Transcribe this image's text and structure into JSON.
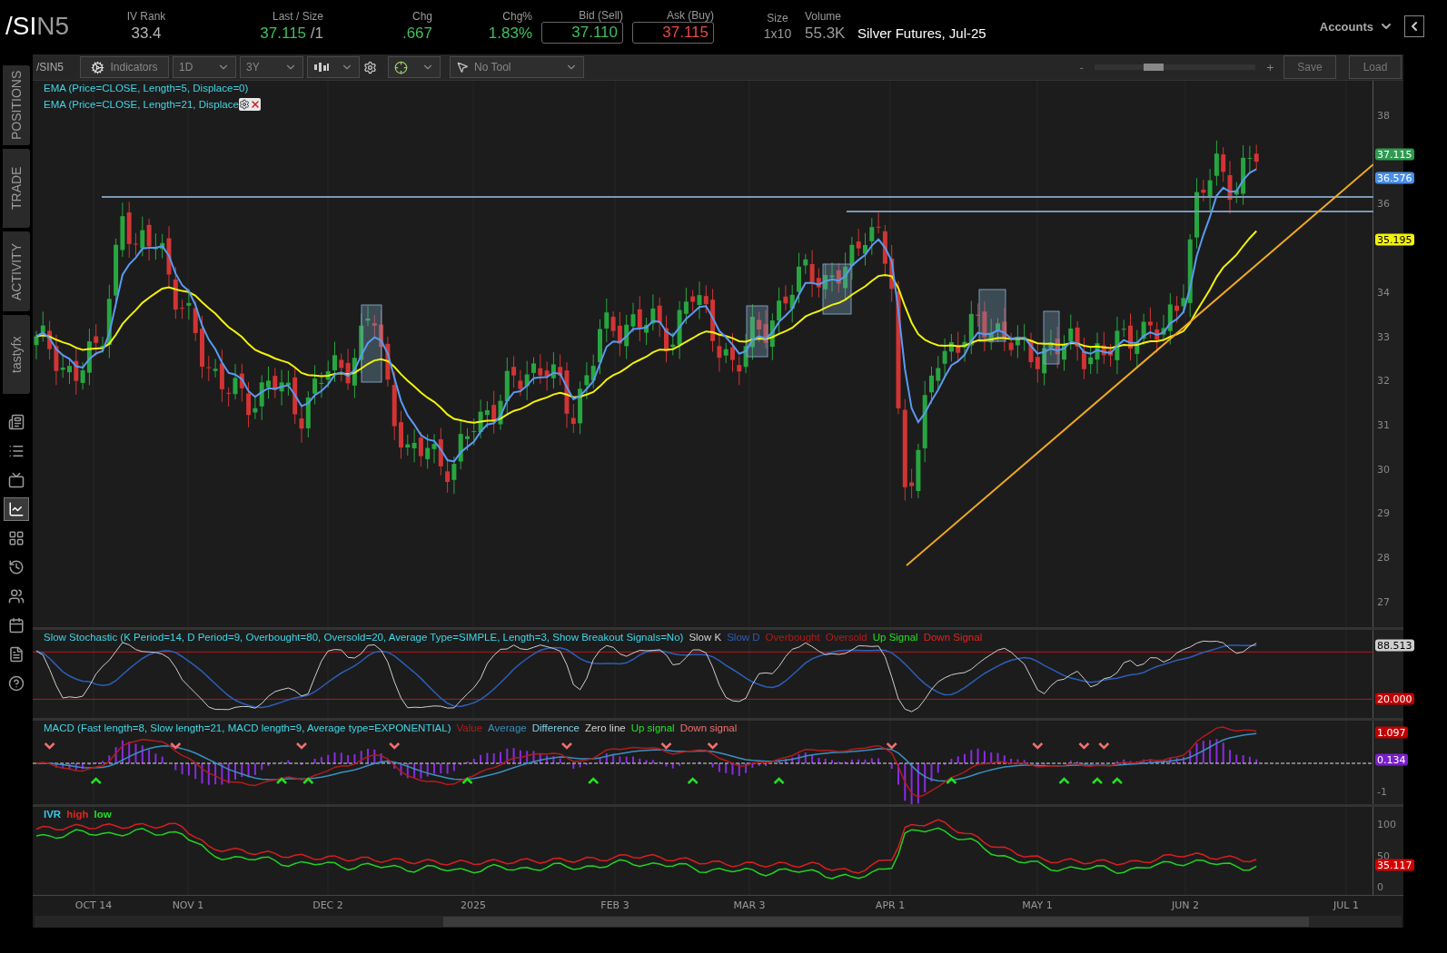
{
  "header": {
    "symbol": {
      "root": "/SI",
      "contract": "N5"
    },
    "quotes": [
      {
        "label": "IV Rank",
        "value": "33.4",
        "kind": "plain",
        "color": "#b5b5b5"
      },
      {
        "label": "Last / Size",
        "value": "37.115",
        "extra": "/1",
        "kind": "plain",
        "color": "#3fbf5f"
      },
      {
        "label": "Chg",
        "value": ".667",
        "kind": "plain",
        "color": "#3fbf5f"
      },
      {
        "label": "Chg%",
        "value": "1.83%",
        "kind": "plain",
        "color": "#3fbf5f"
      },
      {
        "label": "Bid (Sell)",
        "value": "37.110",
        "kind": "boxed",
        "color": "#3fbf5f"
      },
      {
        "label": "Ask (Buy)",
        "value": "37.115",
        "kind": "boxed",
        "color": "#e84848"
      },
      {
        "label": "Size",
        "value": "1x10",
        "kind": "small",
        "color": "#9a9a9a"
      },
      {
        "label": "Volume",
        "value": "55.3K",
        "kind": "plain",
        "color": "#9a9a9a"
      }
    ],
    "description": "Silver Futures, Jul-25",
    "accounts": "Accounts"
  },
  "sidebar": {
    "tabs": [
      {
        "label": "POSITIONS",
        "selected": false
      },
      {
        "label": "TRADE",
        "selected": false
      },
      {
        "label": "ACTIVITY",
        "selected": false
      },
      {
        "label": "tastyfx",
        "selected": false
      }
    ],
    "icons": [
      {
        "kind": "news",
        "selected": false
      },
      {
        "kind": "list",
        "selected": false
      },
      {
        "kind": "tv",
        "selected": false
      },
      {
        "kind": "chart",
        "selected": true
      },
      {
        "kind": "grid",
        "selected": false
      },
      {
        "kind": "history",
        "selected": false
      },
      {
        "kind": "community",
        "selected": false
      },
      {
        "kind": "calendar",
        "selected": false
      },
      {
        "kind": "document",
        "selected": false
      },
      {
        "kind": "help",
        "selected": false
      }
    ]
  },
  "toolbar": {
    "symbol": "/SIN5",
    "indicators": "Indicators",
    "aggregation": "1D",
    "range": "3Y",
    "tool": "No Tool",
    "zoom": {
      "minus": "-",
      "plus": "+",
      "level": 0.35
    },
    "buttons": [
      "Save",
      "Load"
    ]
  },
  "chart": {
    "studies": [
      {
        "label": "EMA (Price=CLOSE, Length=5, Displace=0)",
        "has_controls": false
      },
      {
        "label": "EMA (Price=CLOSE, Length=21, Displace",
        "has_controls": true
      }
    ],
    "price_ticks": [
      "38",
      "36",
      "34",
      "33",
      "32",
      "31",
      "30",
      "29",
      "28",
      "27"
    ],
    "price_tags": [
      {
        "value": "37.115",
        "color": "#2e9b4e"
      },
      {
        "value": "36.576",
        "color": "#4a8fe8"
      },
      {
        "value": "35.195",
        "color": "#f2f20a"
      }
    ]
  },
  "stochastic": {
    "title": "Slow Stochastic (K Period=14, D Period=9, Overbought=80, Oversold=20, Average Type=SIMPLE, Length=3, Show Breakout Signals=No)",
    "legend": [
      {
        "label": "Slow K",
        "color": "#d0d0d0"
      },
      {
        "label": "Slow D",
        "color": "#2c5fb8"
      },
      {
        "label": "Overbought",
        "color": "#b01c1c"
      },
      {
        "label": "Oversold",
        "color": "#b01c1c"
      },
      {
        "label": "Up Signal",
        "color": "#22e022"
      },
      {
        "label": "Down Signal",
        "color": "#e02222"
      }
    ],
    "tags": [
      {
        "value": "88.513",
        "color": "#cfcfcf"
      },
      {
        "value": "20.000",
        "color": "#c00000"
      }
    ]
  },
  "macd": {
    "title": "MACD (Fast length=8, Slow length=21, MACD length=9, Average type=EXPONENTIAL)",
    "legend": [
      {
        "label": "Value",
        "color": "#b01c1c"
      },
      {
        "label": "Average",
        "color": "#3a8fc0"
      },
      {
        "label": "Difference",
        "color": "#7fd0e8"
      },
      {
        "label": "Zero line",
        "color": "#d0d0d0"
      },
      {
        "label": "Up signal",
        "color": "#22e022"
      },
      {
        "label": "Down signal",
        "color": "#f07070"
      }
    ],
    "ticks": [
      "-1"
    ],
    "tags": [
      {
        "value": "1.097",
        "color": "#c00000"
      },
      {
        "value": "0.134",
        "color": "#7a1fc8"
      }
    ]
  },
  "ivr": {
    "legend": [
      {
        "label": "IVR",
        "color": "#39c6e0"
      },
      {
        "label": "high",
        "color": "#e02222"
      },
      {
        "label": "low",
        "color": "#22e022"
      }
    ],
    "ticks": [
      "100",
      "50",
      "0"
    ],
    "tags": [
      {
        "value": "35.117",
        "color": "#d40000"
      }
    ]
  },
  "x_axis": [
    "OCT 14",
    "NOV 1",
    "DEC 2",
    "2025",
    "FEB 3",
    "MAR 3",
    "APR 1",
    "MAY 1",
    "JUN 2",
    "JUL 1"
  ]
}
